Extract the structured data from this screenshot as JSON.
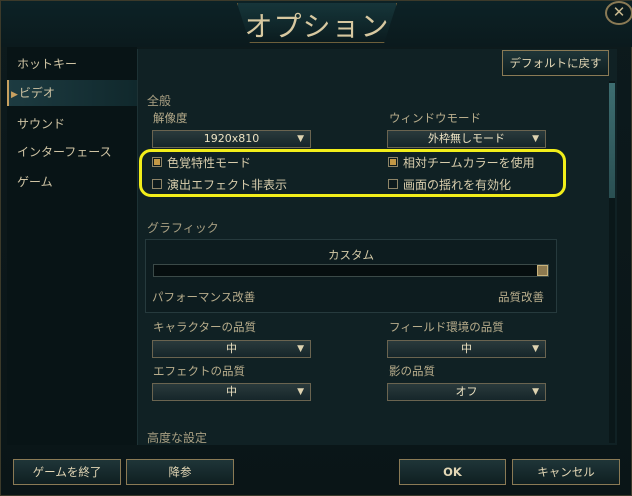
{
  "window": {
    "title": "オプション",
    "close_glyph": "✕"
  },
  "sidebar": {
    "items": [
      {
        "label": "ホットキー",
        "active": false
      },
      {
        "label": "ビデオ",
        "active": true
      },
      {
        "label": "サウンド",
        "active": false
      },
      {
        "label": "インターフェース",
        "active": false
      },
      {
        "label": "ゲーム",
        "active": false
      }
    ]
  },
  "content": {
    "default_button": "デフォルトに戻す",
    "general_section": "全般",
    "resolution": {
      "label": "解像度",
      "value": "1920x810"
    },
    "window_mode": {
      "label": "ウィンドウモード",
      "value": "外枠無しモード"
    },
    "checkboxes": [
      {
        "label": "色覚特性モード",
        "checked": true
      },
      {
        "label": "相対チームカラーを使用",
        "checked": true
      },
      {
        "label": "演出エフェクト非表示",
        "checked": false
      },
      {
        "label": "画面の揺れを有効化",
        "checked": false
      }
    ],
    "graphics_section": "グラフィック",
    "graphics_preset": "カスタム",
    "graphics_slider": {
      "value": 1.0,
      "left_label": "パフォーマンス改善",
      "right_label": "品質改善"
    },
    "character_quality": {
      "label": "キャラクターの品質",
      "value": "中"
    },
    "environment_quality": {
      "label": "フィールド環境の品質",
      "value": "中"
    },
    "effects_quality": {
      "label": "エフェクトの品質",
      "value": "中"
    },
    "shadow_quality": {
      "label": "影の品質",
      "value": "オフ"
    },
    "advanced_section": "高度な設定"
  },
  "footer": {
    "exit_game": "ゲームを終了",
    "surrender": "降参",
    "ok": "OK",
    "cancel": "キャンセル"
  },
  "colors": {
    "highlight": "#f2ee1a",
    "accent_gold": "#c39845",
    "background": "#102124"
  },
  "icons": {
    "dropdown_arrow": "▼"
  }
}
